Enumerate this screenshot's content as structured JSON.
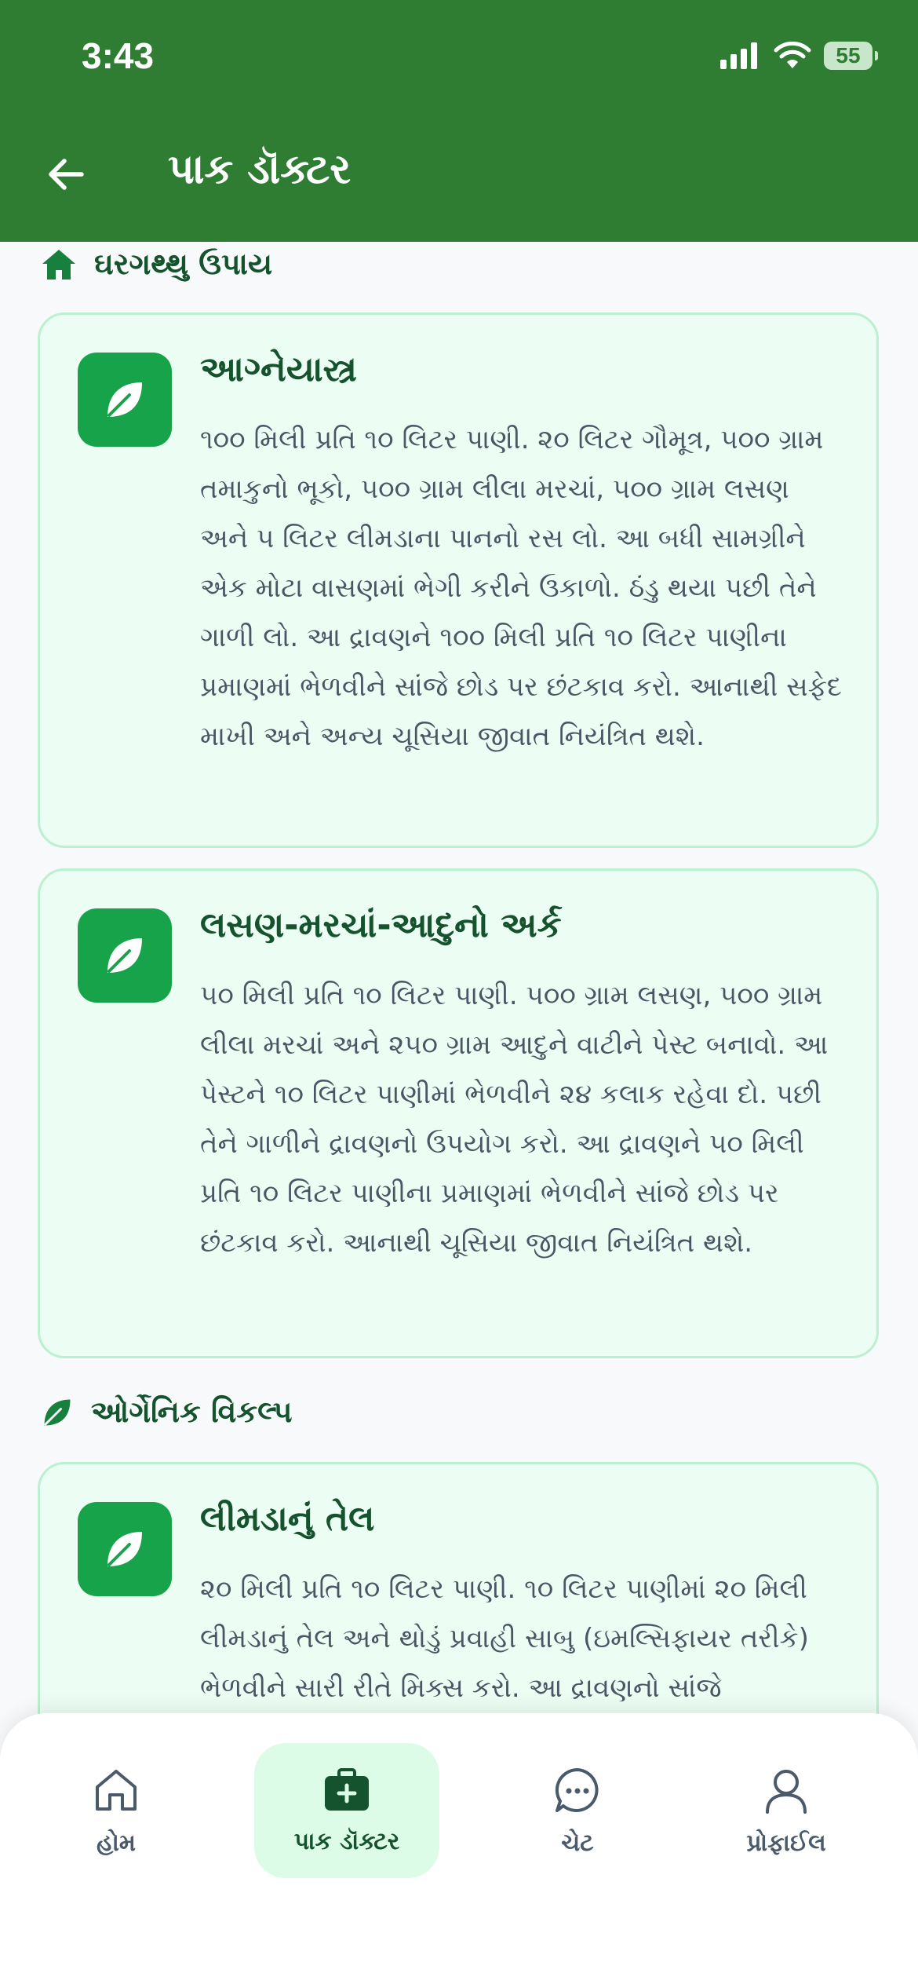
{
  "status_bar": {
    "time": "3:43",
    "battery": "55"
  },
  "header": {
    "title": "પાક ડૉક્ટર"
  },
  "sections": [
    {
      "title": "ઘરગથ્થુ ઉપાય",
      "icon": "home-icon",
      "cards": [
        {
          "title": "આગ્નેયાસ્ત્ર",
          "text": "૧૦૦ મિલી પ્રતિ ૧૦ લિટર પાણી. ૨૦ લિટર ગૌમૂત્ર, ૫૦૦ ગ્રામ તમાકુનો ભૂકો, ૫૦૦ ગ્રામ લીલા મરચાં, ૫૦૦ ગ્રામ લસણ અને ૫ લિટર લીમડાના પાનનો રસ લો. આ બધી સામગ્રીને એક મોટા વાસણમાં ભેગી કરીને ઉકાળો. ઠંડુ થયા પછી તેને ગાળી લો. આ દ્રાવણને ૧૦૦ મિલી પ્રતિ ૧૦ લિટર પાણીના પ્રમાણમાં ભેળવીને સાંજે છોડ પર છંટકાવ કરો. આનાથી સફેદ માખી અને અન્ય ચૂસિયા જીવાત નિયંત્રિત થશે."
        },
        {
          "title": "લસણ-મરચાં-આદુનો અર્ક",
          "text": "૫૦ મિલી પ્રતિ ૧૦ લિટર પાણી. ૫૦૦ ગ્રામ લસણ, ૫૦૦ ગ્રામ લીલા મરચાં અને ૨૫૦ ગ્રામ આદુને વાટીને પેસ્ટ બનાવો. આ પેસ્ટને ૧૦ લિટર પાણીમાં ભેળવીને ૨૪ કલાક રહેવા દો. પછી તેને ગાળીને દ્રાવણનો ઉપયોગ કરો. આ દ્રાવણને ૫૦ મિલી પ્રતિ ૧૦ લિટર પાણીના પ્રમાણમાં ભેળવીને સાંજે છોડ પર છંટકાવ કરો. આનાથી ચૂસિયા જીવાત નિયંત્રિત થશે."
        }
      ]
    },
    {
      "title": "ઓર્ગેનિક વિકલ્પ",
      "icon": "leaf-icon",
      "cards": [
        {
          "title": "લીમડાનું તેલ",
          "text": "૨૦ મિલી પ્રતિ ૧૦ લિટર પાણી. ૧૦ લિટર પાણીમાં ૨૦ મિલી લીમડાનું તેલ અને થોડું પ્રવાહી સાબુ (ઇમલ્સિફાયર તરીકે) ભેળવીને સારી રીતે મિક્સ કરો. આ દ્રાવણનો સાંજે"
        }
      ]
    }
  ],
  "bottom_nav": [
    {
      "label": "હોમ",
      "icon": "home-outline-icon"
    },
    {
      "label": "પાક ડૉક્ટર",
      "icon": "medical-kit-icon",
      "active": true
    },
    {
      "label": "ચેટ",
      "icon": "chat-bubble-icon"
    },
    {
      "label": "પ્રોફાઈલ",
      "icon": "person-icon"
    }
  ],
  "colors": {
    "header": "#2e7d32",
    "accent": "#16a34a",
    "card_bg": "#ecfdf3",
    "active_nav": "#dcfce7"
  }
}
